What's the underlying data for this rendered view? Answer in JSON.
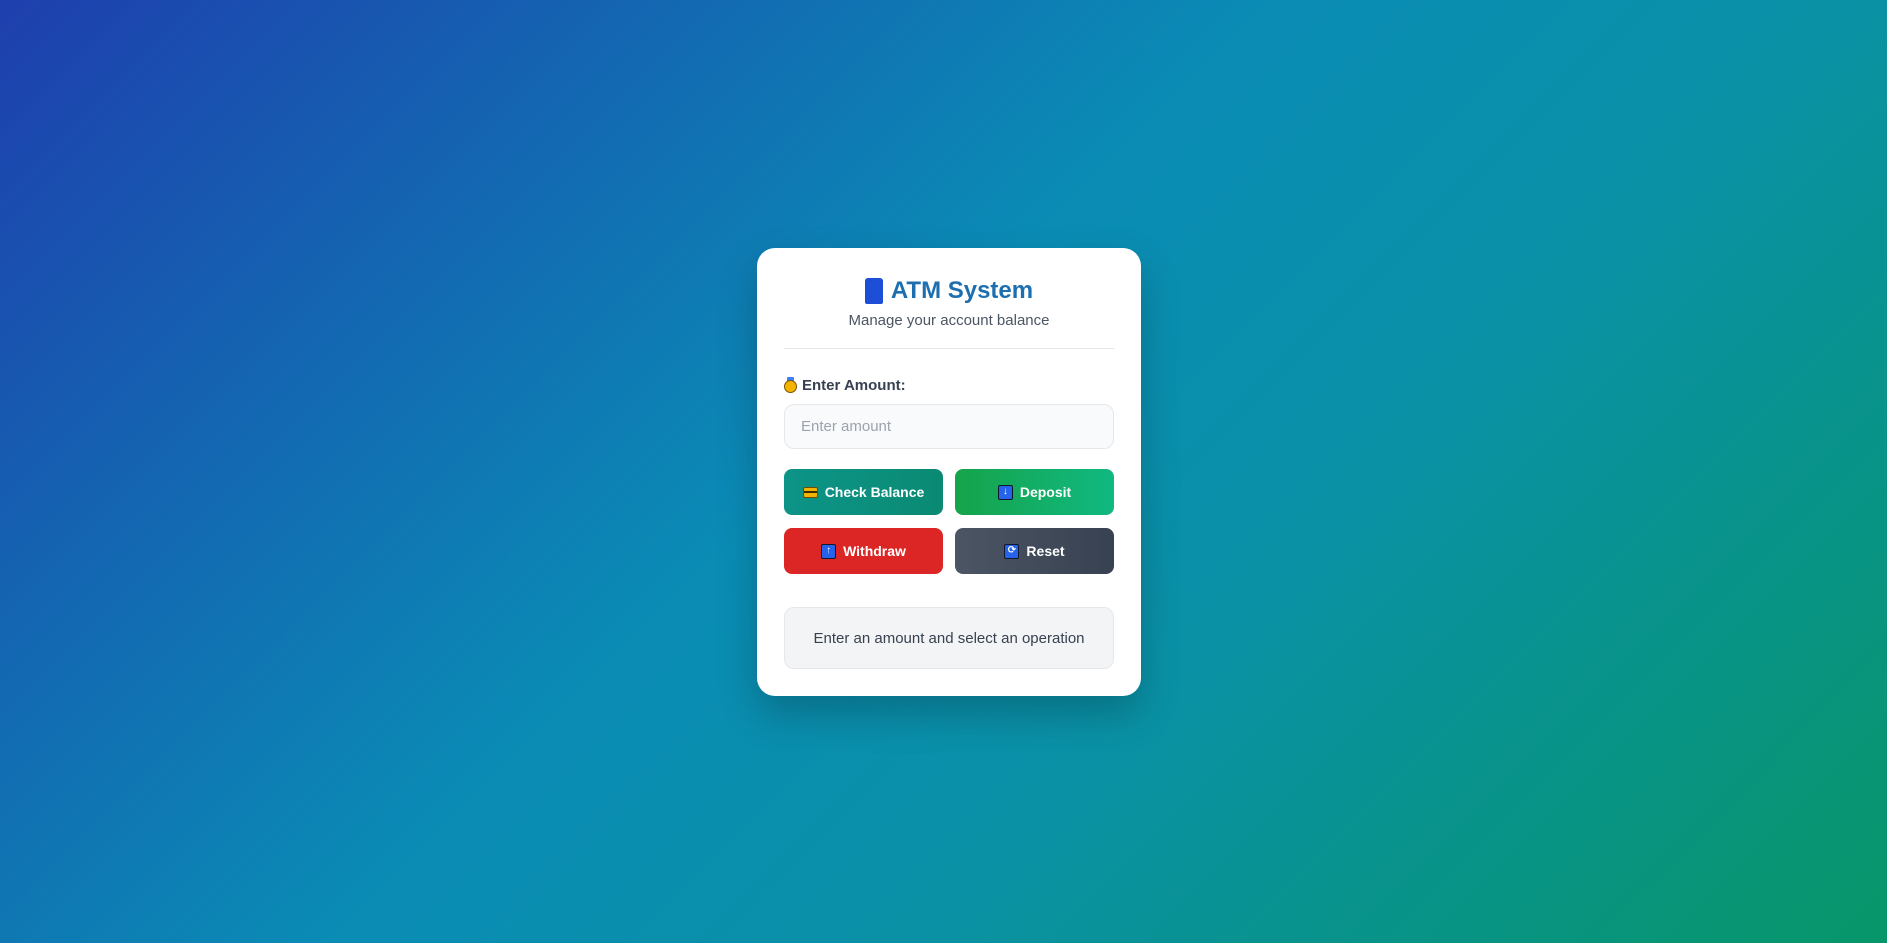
{
  "app": {
    "title": "ATM System",
    "title_icon": "atm-card-icon",
    "subtitle": "Manage your account balance"
  },
  "form": {
    "amount_label": "Enter Amount:",
    "amount_label_icon": "medal-icon",
    "amount_value": "",
    "amount_placeholder": "Enter amount"
  },
  "buttons": {
    "check_balance": {
      "label": "Check Balance",
      "icon": "credit-card-icon",
      "color": "#0d9488"
    },
    "deposit": {
      "label": "Deposit",
      "icon": "down-arrow-icon",
      "glyph": "↓",
      "color": "#16a34a"
    },
    "withdraw": {
      "label": "Withdraw",
      "icon": "up-arrow-icon",
      "glyph": "↑",
      "color": "#dc2626"
    },
    "reset": {
      "label": "Reset",
      "icon": "refresh-icon",
      "glyph": "⟳",
      "color": "#4b5563"
    }
  },
  "status": {
    "message": "Enter an amount and select an operation"
  },
  "colors": {
    "title": "#1d6fb0",
    "background_start": "#1e3fae",
    "background_end": "#079669"
  }
}
